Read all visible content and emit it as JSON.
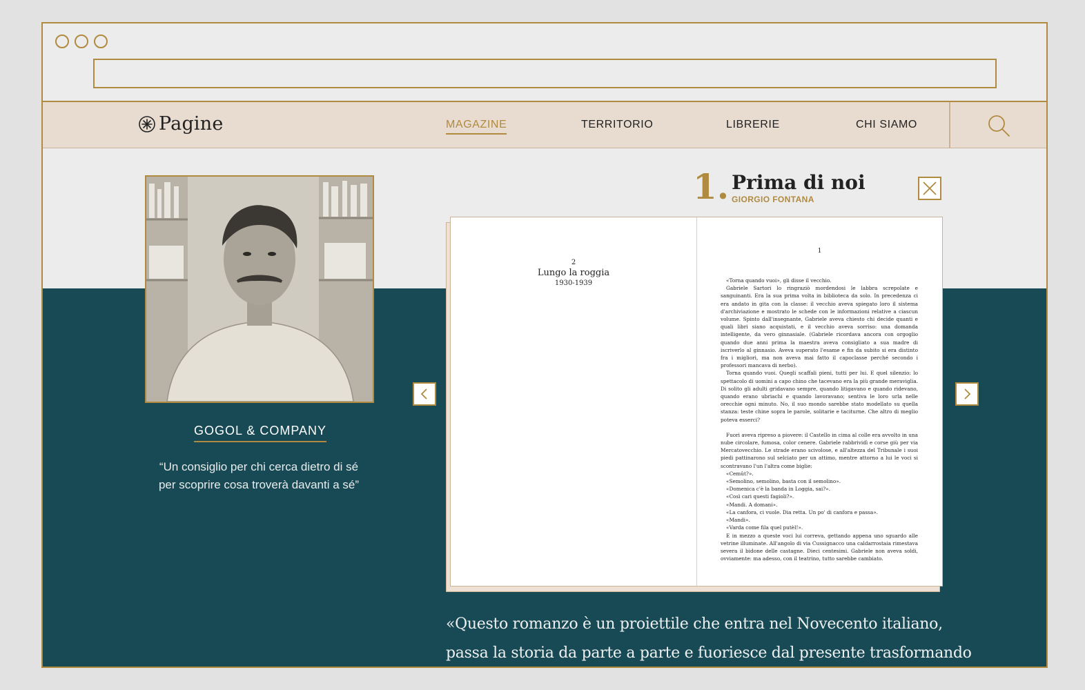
{
  "nav": {
    "logo": "Pagine",
    "items": [
      "MAGAZINE",
      "TERRITORIO",
      "LIBRERIE",
      "CHI SIAMO"
    ]
  },
  "store": {
    "name": "GOGOL & COMPANY",
    "quote_line1": "“Un consiglio per chi cerca dietro di sé",
    "quote_line2": "per scoprire cosa troverà davanti a sé”"
  },
  "book": {
    "number": "1.",
    "title": "Prima di noi",
    "author": "GIORGIO FONTANA",
    "left_page": {
      "chapter_number": "2",
      "chapter_title": "Lungo la roggia",
      "years": "1930-1939"
    },
    "right_page": {
      "page_number": "1",
      "paragraphs": [
        "«Torna quando vuoi», gli disse il vecchio.",
        "Gabriele Sartori lo ringraziò mordendosi le labbra screpolate e sanguinanti. Era la sua prima volta in biblioteca da solo. In precedenza ci era andato in gita con la classe: il vecchio aveva spiegato loro il sistema d'archiviazione e mostrato le schede con le informazioni relative a ciascun volume. Spinto dall'insegnante, Gabriele aveva chiesto chi decide quanti e quali libri siano acquistati, e il vecchio aveva sorriso: una domanda intelligente, da vero ginnasiale. (Gabriele ricordava ancora con orgoglio quando due anni prima la maestra aveva consigliato a sua madre di iscriverlo al ginnasio. Aveva superato l'esame e fin da subito si era distinto fra i migliori, ma non aveva mai fatto il capoclasse perché secondo i professori mancava di nerbo).",
        "Torna quando vuoi. Quegli scaffali pieni, tutti per lui. E quel silenzio: lo spettacolo di uomini a capo chino che tacevano era la più grande meraviglia. Di solito gli adulti gridavano sempre, quando litigavano e quando ridevano, quando erano ubriachi e quando lavoravano; sentiva le loro urla nelle orecchie ogni minuto. No, il suo mondo sarebbe stato modellato su quella stanza: teste chine sopra le parole, solitarie e taciturne. Che altro di meglio poteva esserci?",
        "Fuori aveva ripreso a piovere: il Castello in cima al colle era avvolto in una nube circolare, fumosa, color cenere. Gabriele rabbrividì e corse giù per via Mercatovecchio. Le strade erano scivolose, e all'altezza del Tribunale i suoi piedi pattinarono sul selciato per un attimo, mentre attorno a lui le voci si scontravano l'un l'altra come biglie:",
        "«Cemût?».",
        "«Semolino, semolino, basta con il semolino».",
        "«Domenica c'è la banda in Loggia, sai?».",
        "«Così cari questi fagioli?».",
        "«Mandi. A domani».",
        "«La canfora, ci vuole. Dia retta. Un po' di canfora e passa».",
        "«Mandi».",
        "«Varda come fila quel putèl!».",
        "E in mezzo a queste voci lui correva, gettando appena uno sguardo alle vetrine illuminate. All'angolo di via Cussignacco una caldarrostaia rimestava severa il bidone delle castagne. Dieci centesimi. Gabriele non aveva soldi, ovviamente: ma adesso, con il teatrino, tutto sarebbe cambiato."
      ]
    }
  },
  "review": {
    "line1": "«Questo romanzo è un proiettile che entra nel Novecento italiano,",
    "line2": "passa la storia da parte a parte e fuoriesce dal presente trasformando"
  },
  "icons": {
    "logo": "asterisk-circle-icon",
    "search": "search-icon",
    "close": "close-icon",
    "prev": "chevron-left-icon",
    "next": "chevron-right-icon"
  },
  "colors": {
    "accent": "#b08a3e",
    "nav_bg": "#e8dbd0",
    "teal": "#184a55",
    "page_bg": "#ececec"
  }
}
